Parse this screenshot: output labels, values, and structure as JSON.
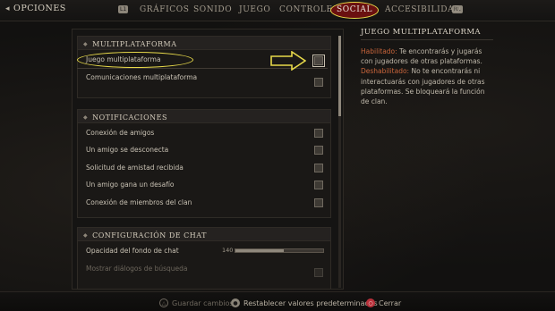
{
  "window": {
    "title": "OPCIONES"
  },
  "tabs": [
    {
      "label": "GRÁFICOS"
    },
    {
      "label": "SONIDO"
    },
    {
      "label": "JUEGO"
    },
    {
      "label": "CONTROLES"
    },
    {
      "label": "SOCIAL",
      "active": true
    },
    {
      "label": "ACCESIBILIDAD"
    }
  ],
  "tab_hints": {
    "left": "L1",
    "right": "R1"
  },
  "sections": [
    {
      "title": "MULTIPLATAFORMA",
      "items": [
        {
          "label": "Juego multiplataforma",
          "checked": false,
          "selected": true
        },
        {
          "label": "Comunicaciones multiplataforma",
          "checked": false
        }
      ]
    },
    {
      "title": "NOTIFICACIONES",
      "items": [
        {
          "label": "Conexión de amigos",
          "checked": false
        },
        {
          "label": "Un amigo se desconecta",
          "checked": false
        },
        {
          "label": "Solicitud de amistad recibida",
          "checked": false
        },
        {
          "label": "Un amigo gana un desafío",
          "checked": false
        },
        {
          "label": "Conexión de miembros del clan",
          "checked": false
        }
      ]
    },
    {
      "title": "CONFIGURACIÓN DE CHAT",
      "items": [
        {
          "label": "Opacidad del fondo de chat",
          "value": "140",
          "fraction": 0.55
        },
        {
          "label": "Mostrar diálogos de búsqueda",
          "checked": false
        }
      ]
    }
  ],
  "info": {
    "title": "JUEGO MULTIPLATAFORMA",
    "enabled_label": "Habilitado:",
    "enabled_text": " Te encontrarás y jugarás con jugadores de otras plataformas.",
    "disabled_label": "Deshabilitado:",
    "disabled_text": " No te encontrarás ni interactuarás con jugadores de otras plataformas. Se bloqueará la función de clan."
  },
  "footer": {
    "save": "Guardar cambios",
    "reset": "Restablecer valores predeterminados",
    "cancel": "Cerrar"
  },
  "colors": {
    "accent_highlight": "#e7d94a",
    "active_tab": "#6a1010",
    "info_keyword": "#c9653b"
  }
}
